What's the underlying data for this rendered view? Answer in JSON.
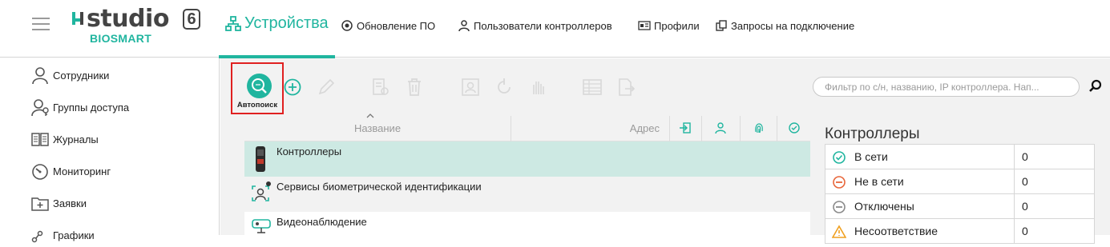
{
  "app": {
    "logo_text": "studio",
    "logo_version": "6",
    "logo_sub": "BIOSMART"
  },
  "header": {
    "active_section": "Устройства",
    "nav": [
      {
        "label": "Обновление ПО",
        "icon": "update-icon"
      },
      {
        "label": "Пользователи контроллеров",
        "icon": "user-icon"
      },
      {
        "label": "Профили",
        "icon": "profile-card-icon"
      },
      {
        "label": "Запросы на подключение",
        "icon": "connect-request-icon"
      }
    ]
  },
  "sidebar": {
    "items": [
      {
        "label": "Сотрудники",
        "icon": "person-icon"
      },
      {
        "label": "Группы доступа",
        "icon": "access-group-icon"
      },
      {
        "label": "Журналы",
        "icon": "journal-icon"
      },
      {
        "label": "Мониторинг",
        "icon": "monitoring-icon"
      },
      {
        "label": "Заявки",
        "icon": "requests-icon"
      },
      {
        "label": "Графики",
        "icon": "schedule-icon"
      }
    ]
  },
  "toolbar": {
    "autosearch_label": "Автопоиск",
    "filter_placeholder": "Фильтр по с/н, названию, IP контроллера. Нап..."
  },
  "table": {
    "columns": {
      "name": "Название",
      "address": "Адрес"
    },
    "rows": [
      {
        "label": "Контроллеры",
        "icon": "controller-device-icon",
        "selected": true
      },
      {
        "label": "Сервисы биометрической идентификации",
        "icon": "biometric-service-icon",
        "selected": false
      },
      {
        "label": "Видеонаблюдение",
        "icon": "cctv-icon",
        "selected": false
      }
    ]
  },
  "controllers_panel": {
    "title": "Контроллеры",
    "rows": [
      {
        "label": "В сети",
        "value": "0",
        "icon": "online-check-icon",
        "color": "#20b59f"
      },
      {
        "label": "Не в сети",
        "value": "0",
        "icon": "offline-minus-icon",
        "color": "#e8663a"
      },
      {
        "label": "Отключены",
        "value": "0",
        "icon": "disabled-minus-icon",
        "color": "#8a8a8a"
      },
      {
        "label": "Несоответствие",
        "value": "0",
        "icon": "mismatch-warning-icon",
        "color": "#f0a020"
      }
    ]
  },
  "colors": {
    "accent": "#20b59f",
    "selected_row": "#cde9e3",
    "highlight_border": "#e02020"
  }
}
